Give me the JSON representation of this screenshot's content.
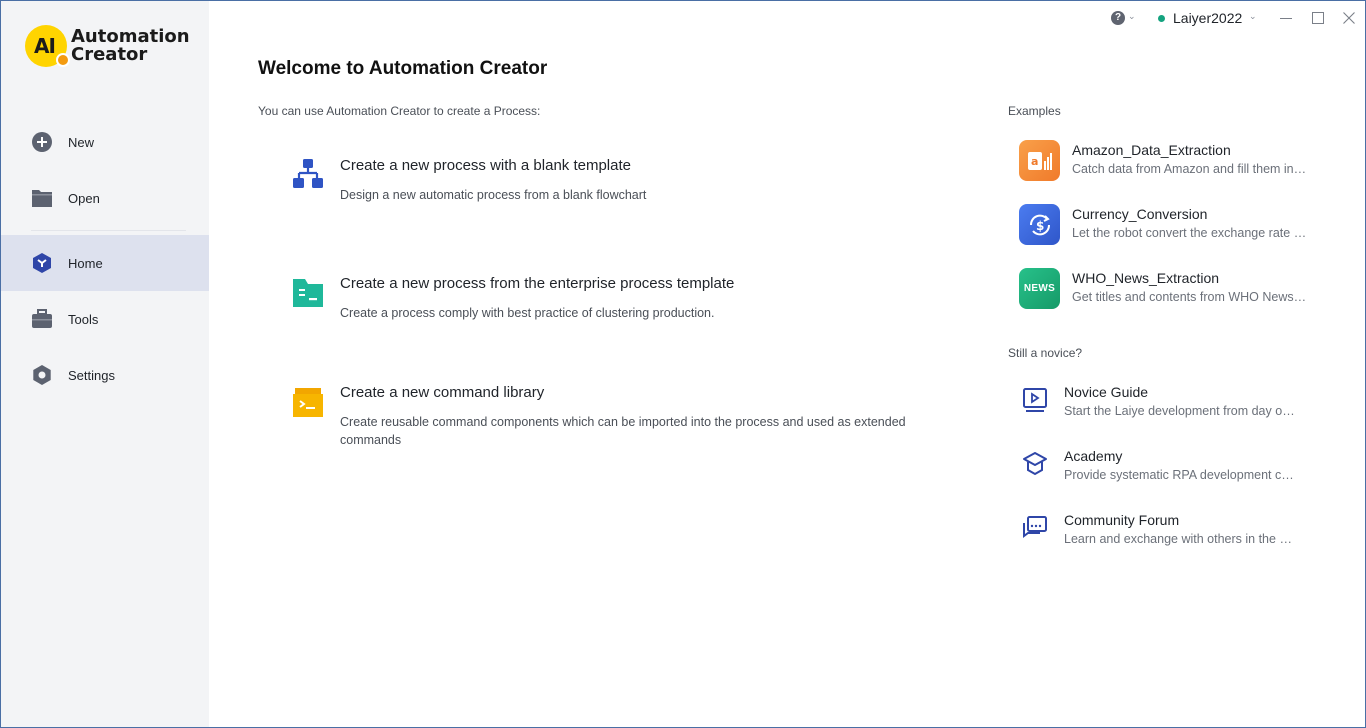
{
  "app": {
    "logo_mark": "AI",
    "logo_line1": "Automation",
    "logo_line2": "Creator"
  },
  "sidebar": {
    "items": [
      {
        "label": "New",
        "icon": "plus-circle-icon"
      },
      {
        "label": "Open",
        "icon": "folder-icon"
      },
      {
        "label": "Home",
        "icon": "home-hexagon-icon",
        "active": true
      },
      {
        "label": "Tools",
        "icon": "toolbox-icon"
      },
      {
        "label": "Settings",
        "icon": "gear-icon"
      }
    ]
  },
  "titlebar": {
    "help_icon": "?",
    "user_name": "Laiyer2022",
    "status_color": "#14a37f"
  },
  "main": {
    "title": "Welcome to Automation Creator",
    "subtitle": "You can use Automation Creator to create a Process:",
    "options": [
      {
        "title": "Create a new process with a blank template",
        "desc": "Design a new automatic process from a blank flowchart",
        "icon": "flowchart-icon",
        "color": "#2f54c4"
      },
      {
        "title": "Create a new process from the enterprise process template",
        "desc": "Create a process comply with best practice of clustering production.",
        "icon": "enterprise-template-icon",
        "color": "#1fb89a"
      },
      {
        "title": "Create a new command library",
        "desc": "Create reusable command components which can be imported into the process and used as extended commands",
        "icon": "command-library-icon",
        "color": "#f7b500"
      }
    ]
  },
  "examples": {
    "label": "Examples",
    "items": [
      {
        "title": "Amazon_Data_Extraction",
        "desc": "Catch data from Amazon and fill them into Excel",
        "icon": "amazon-chart-icon",
        "color": "#f6913e"
      },
      {
        "title": "Currency_Conversion",
        "desc": "Let the robot convert the exchange rate automatically",
        "icon": "currency-icon",
        "color": "#3f6fe0"
      },
      {
        "title": "WHO_News_Extraction",
        "desc": "Get titles and contents from WHO News website",
        "icon": "news-icon",
        "icon_text": "NEWS",
        "color": "#1fb37a"
      }
    ]
  },
  "novice": {
    "label": "Still a novice?",
    "items": [
      {
        "title": "Novice Guide",
        "desc": "Start the Laiye development from day one",
        "icon": "video-play-icon"
      },
      {
        "title": "Academy",
        "desc": "Provide systematic RPA development courses",
        "icon": "graduation-cap-icon"
      },
      {
        "title": "Community Forum",
        "desc": "Learn and exchange with others in the community",
        "icon": "chat-bubbles-icon"
      }
    ]
  }
}
